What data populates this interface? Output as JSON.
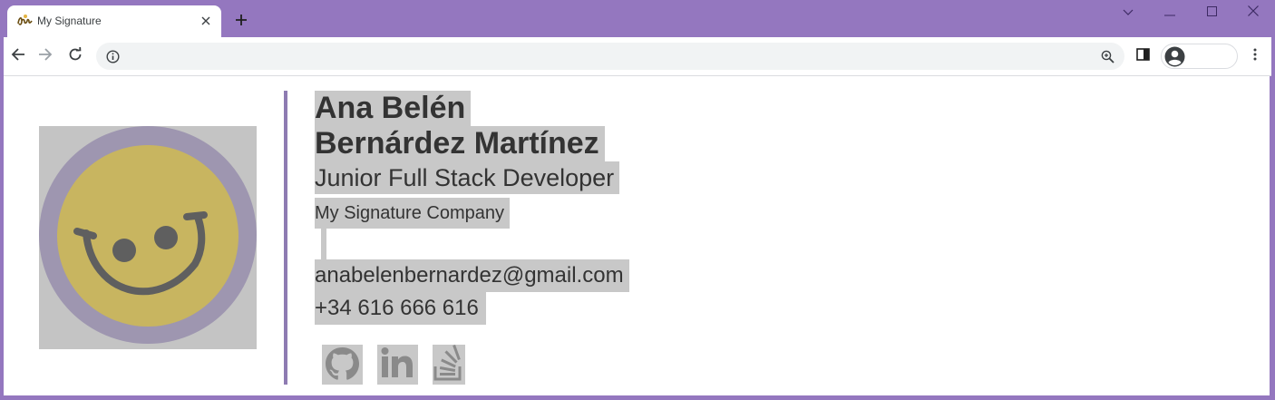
{
  "browser": {
    "tab": {
      "title": "My Signature"
    },
    "icons": {
      "favicon": "signature-favicon",
      "close": "close-icon",
      "new_tab": "plus-icon",
      "back": "back-arrow-icon",
      "forward": "forward-arrow-icon",
      "reload": "reload-icon",
      "info": "info-icon",
      "zoom": "zoom-icon",
      "side_panel": "side-panel-icon",
      "profile": "profile-icon",
      "menu": "kebab-menu-icon"
    },
    "colors": {
      "frame": "#9477bf",
      "omnibox": "#f1f3f4"
    }
  },
  "signature": {
    "name_line1": "Ana Belén",
    "name_line2": "Bernárdez Martínez",
    "role": "Junior Full Stack Developer",
    "company": "My Signature Company",
    "email": "anabelenbernardez@gmail.com",
    "phone": "+34 616 666 616",
    "social_icons": [
      "github-icon",
      "linkedin-icon",
      "stackoverflow-icon"
    ],
    "colors": {
      "highlight": "#c8c8c8",
      "divider": "#8e7bb2",
      "avatar_ring": "#9e96b0",
      "avatar_face": "#c8b560",
      "avatar_features": "#5f5f5f",
      "text": "#333333"
    }
  }
}
